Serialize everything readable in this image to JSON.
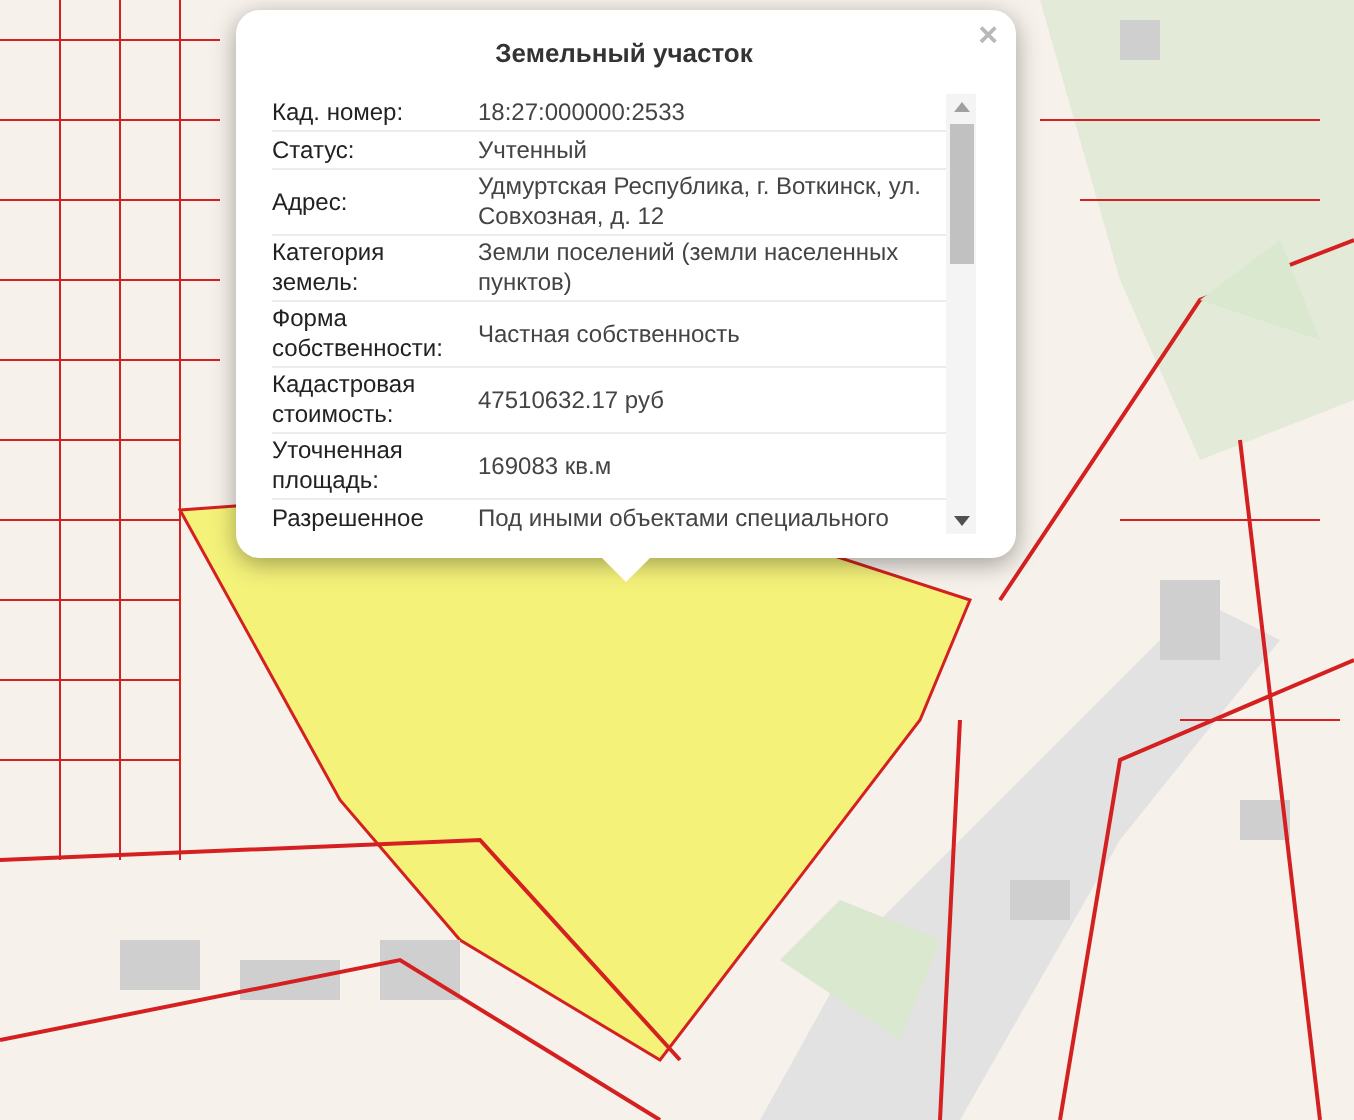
{
  "popup": {
    "title": "Земельный участок",
    "close_glyph": "×",
    "rows": [
      {
        "label": "Кад. номер:",
        "value": "18:27:000000:2533"
      },
      {
        "label": "Статус:",
        "value": "Учтенный"
      },
      {
        "label": "Адрес:",
        "value": "Удмуртская Республика, г. Воткинск, ул. Совхозная, д. 12"
      },
      {
        "label": "Категория земель:",
        "value": "Земли поселений (земли населенных пунктов)"
      },
      {
        "label": "Форма собственности:",
        "value": "Частная собственность"
      },
      {
        "label": "Кадастровая стоимость:",
        "value": "47510632.17 руб"
      },
      {
        "label": "Уточненная площадь:",
        "value": "169083 кв.м"
      },
      {
        "label": "Разрешенное",
        "value": "Под иными объектами специального"
      }
    ]
  }
}
